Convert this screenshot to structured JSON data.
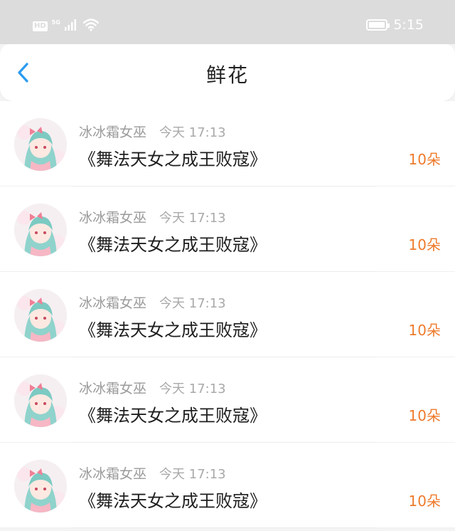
{
  "status_bar": {
    "hd_badge": "HD",
    "network": "5G",
    "time": "5:15",
    "battery_level": 1.0
  },
  "header": {
    "title": "鲜花",
    "back_icon": "chevron-left-icon"
  },
  "colors": {
    "accent": "#2a9bf0",
    "count_orange": "#ee7a2b",
    "statusbar_bg": "#dcdcdc"
  },
  "items": [
    {
      "user": "冰冰霜女巫",
      "time": "今天 17:13",
      "book": "《舞法天女之成王败寇》",
      "count": "10朵"
    },
    {
      "user": "冰冰霜女巫",
      "time": "今天 17:13",
      "book": "《舞法天女之成王败寇》",
      "count": "10朵"
    },
    {
      "user": "冰冰霜女巫",
      "time": "今天 17:13",
      "book": "《舞法天女之成王败寇》",
      "count": "10朵"
    },
    {
      "user": "冰冰霜女巫",
      "time": "今天 17:13",
      "book": "《舞法天女之成王败寇》",
      "count": "10朵"
    },
    {
      "user": "冰冰霜女巫",
      "time": "今天 17:13",
      "book": "《舞法天女之成王败寇》",
      "count": "10朵"
    }
  ]
}
